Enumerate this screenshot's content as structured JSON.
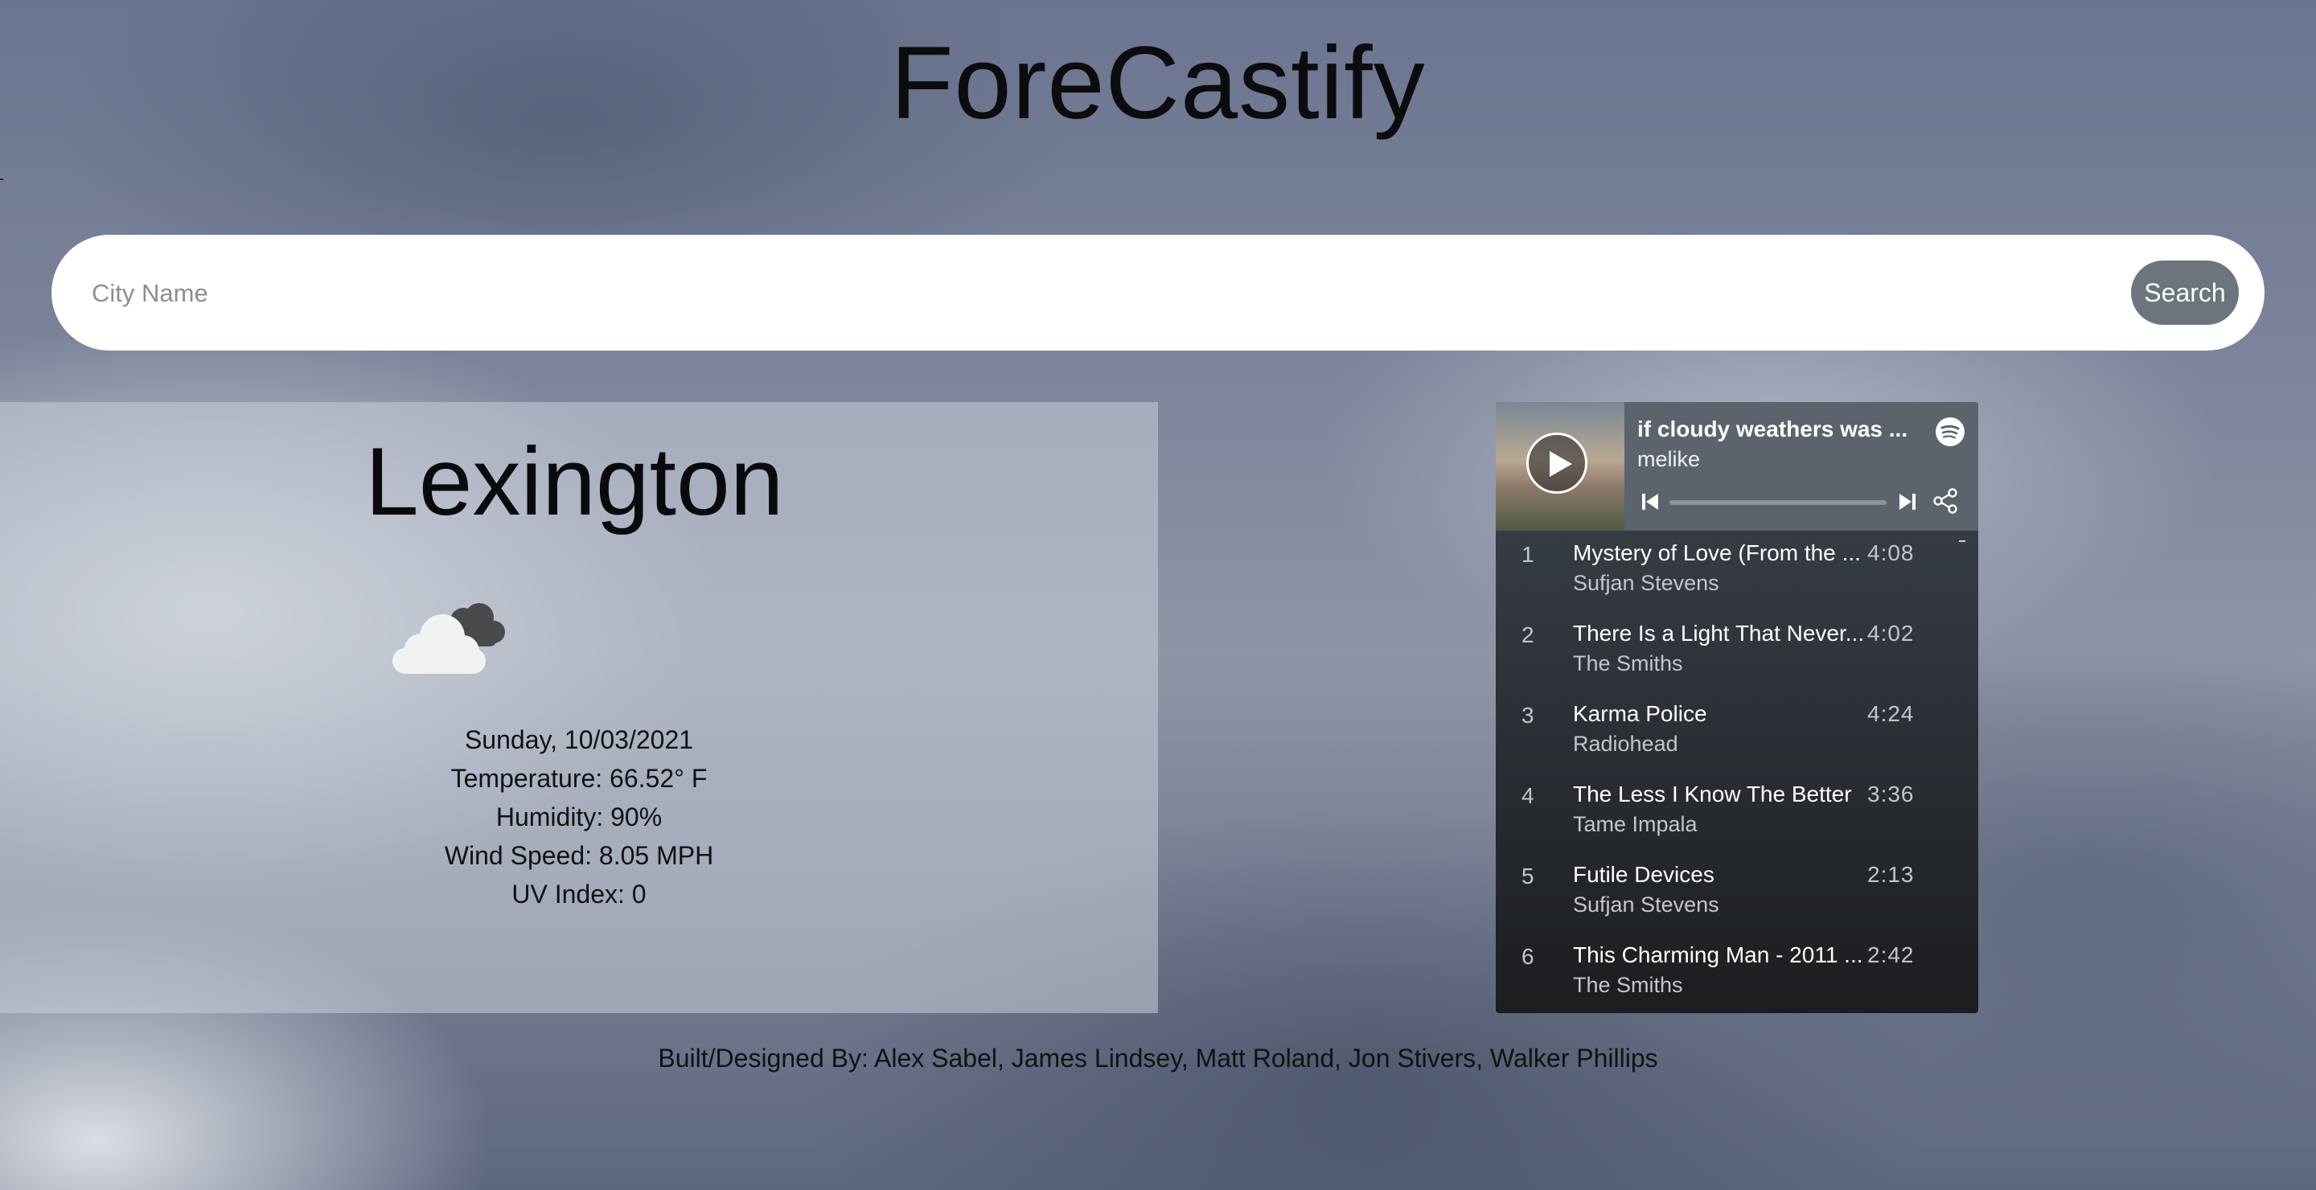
{
  "app": {
    "title": "ForeCastify"
  },
  "search": {
    "placeholder": "City Name",
    "value": "",
    "button_label": "Search"
  },
  "weather": {
    "city": "Lexington",
    "icon": "cloudy-icon",
    "date": "Sunday, 10/03/2021",
    "temperature": "Temperature: 66.52° F",
    "humidity": "Humidity: 90%",
    "wind_speed": "Wind Speed: 8.05 MPH",
    "uv_index": "UV Index: 0"
  },
  "player": {
    "playlist_title": "if cloudy weathers was ...",
    "owner": "melike",
    "progress": 0,
    "icons": {
      "play": "play-icon",
      "brand": "spotify-icon",
      "previous": "skip-previous-icon",
      "next": "skip-next-icon",
      "share": "share-icon"
    },
    "tracks": [
      {
        "number": "1",
        "name": "Mystery of Love (From the ...",
        "artist": "Sufjan Stevens",
        "duration": "4:08"
      },
      {
        "number": "2",
        "name": "There Is a Light That Never...",
        "artist": "The Smiths",
        "duration": "4:02"
      },
      {
        "number": "3",
        "name": "Karma Police",
        "artist": "Radiohead",
        "duration": "4:24"
      },
      {
        "number": "4",
        "name": "The Less I Know The Better",
        "artist": "Tame Impala",
        "duration": "3:36"
      },
      {
        "number": "5",
        "name": "Futile Devices",
        "artist": "Sufjan Stevens",
        "duration": "2:13"
      },
      {
        "number": "6",
        "name": "This Charming Man - 2011 ...",
        "artist": "The Smiths",
        "duration": "2:42"
      }
    ]
  },
  "footer": {
    "credits": "Built/Designed By: Alex Sabel, James Lindsey, Matt Roland, Jon Stivers, Walker Phillips"
  },
  "colors": {
    "search_button": "#6c757d",
    "player_header": "#5b636c"
  }
}
